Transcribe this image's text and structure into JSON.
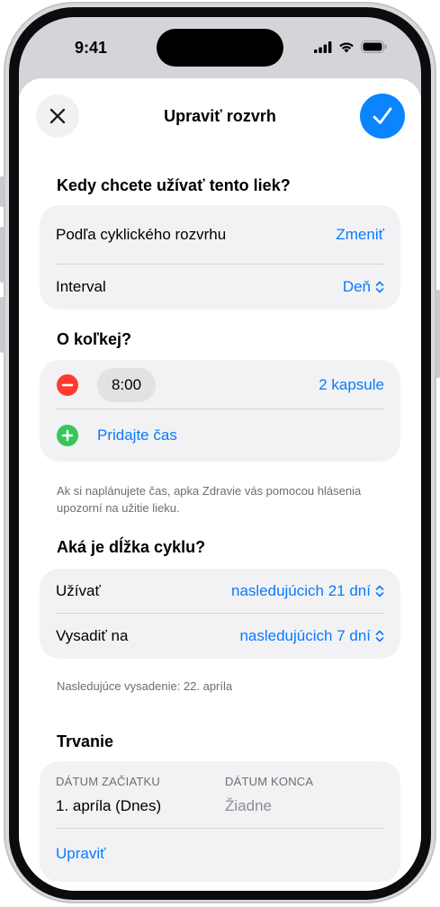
{
  "status": {
    "time": "9:41"
  },
  "header": {
    "title": "Upraviť rozvrh"
  },
  "schedule": {
    "question": "Kedy chcete užívať tento liek?",
    "type_label": "Podľa cyklického rozvrhu",
    "type_action": "Zmeniť",
    "interval_label": "Interval",
    "interval_value": "Deň"
  },
  "times": {
    "question": "O koľkej?",
    "entry_time": "8:00",
    "entry_dose": "2 kapsule",
    "add_label": "Pridajte čas",
    "footnote": "Ak si naplánujete čas, apka Zdravie vás pomocou hlásenia upozorní na užitie lieku."
  },
  "cycle": {
    "question": "Aká je dĺžka cyklu?",
    "take_label": "Užívať",
    "take_value": "nasledujúcich 21 dní",
    "pause_label": "Vysadiť na",
    "pause_value": "nasledujúcich 7 dní",
    "footnote": "Nasledujúce vysadenie: 22. apríla"
  },
  "duration": {
    "title": "Trvanie",
    "start_caption": "DÁTUM ZAČIATKU",
    "start_value": "1. apríla (Dnes)",
    "end_caption": "DÁTUM KONCA",
    "end_value": "Žiadne",
    "edit_label": "Upraviť"
  },
  "colors": {
    "accent": "#0a7aff",
    "remove": "#ff3b30",
    "add": "#34c759"
  },
  "icons": [
    "close-icon",
    "checkmark-icon",
    "minus-icon",
    "plus-icon",
    "chevron-up-down-icon",
    "signal-icon",
    "wifi-icon",
    "battery-icon"
  ]
}
